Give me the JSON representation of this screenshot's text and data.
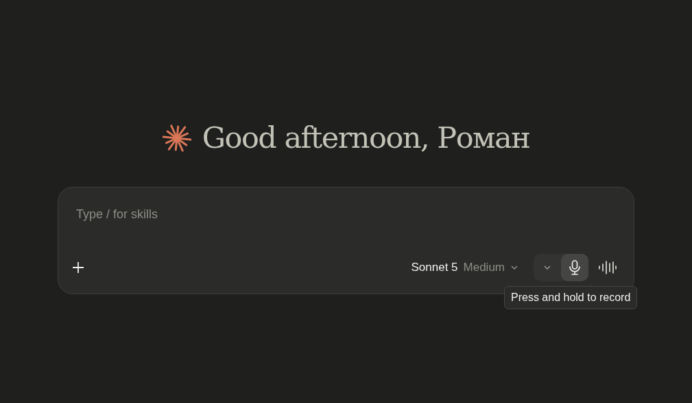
{
  "greeting": "Good afternoon, Роман",
  "composer": {
    "placeholder": "Type / for skills",
    "model": {
      "name": "Sonnet 5",
      "effort": "Medium"
    },
    "mic_button": {
      "highlighted": true
    },
    "tooltip": "Press and hold to record"
  }
}
